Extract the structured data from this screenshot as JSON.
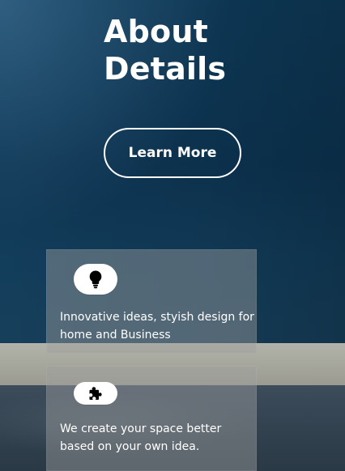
{
  "hero": {
    "title_line1": "About",
    "title_line2": "Details",
    "cta_label": "Learn More"
  },
  "cards": [
    {
      "icon": "lightbulb-icon",
      "text": "Innovative ideas, styish design for home and Business"
    },
    {
      "icon": "puzzle-icon",
      "text": "We create your space better based on your own idea."
    }
  ],
  "colors": {
    "text": "#ffffff",
    "wall": "#0e3b5a",
    "card_overlay": "rgba(160,160,160,0.45)",
    "pill_bg": "#ffffff",
    "icon": "#000000"
  }
}
